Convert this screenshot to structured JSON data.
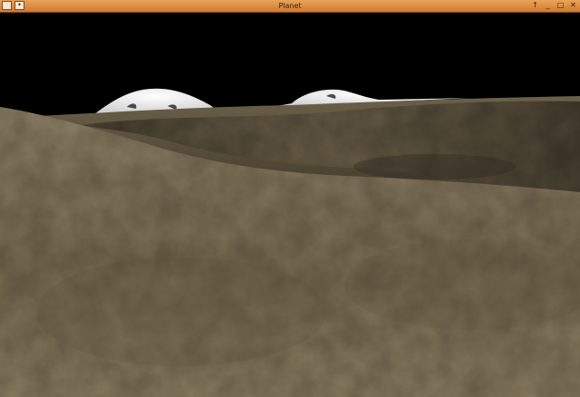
{
  "window": {
    "title": "Planet",
    "menu_icon": "window-menu-icon",
    "pin_icon": "pin-icon",
    "buttons": {
      "up": "↑",
      "minimize": "_",
      "maximize": "□",
      "close": "✕"
    },
    "button_icons": [
      "up-arrow-icon",
      "minimize-icon",
      "maximize-icon",
      "close-icon"
    ]
  },
  "scene": {
    "sky_color": "#000000",
    "terrain_colors": [
      "#8a7b5f",
      "#5a5038",
      "#3a3325"
    ],
    "snow_color": "#e9e9e9"
  }
}
